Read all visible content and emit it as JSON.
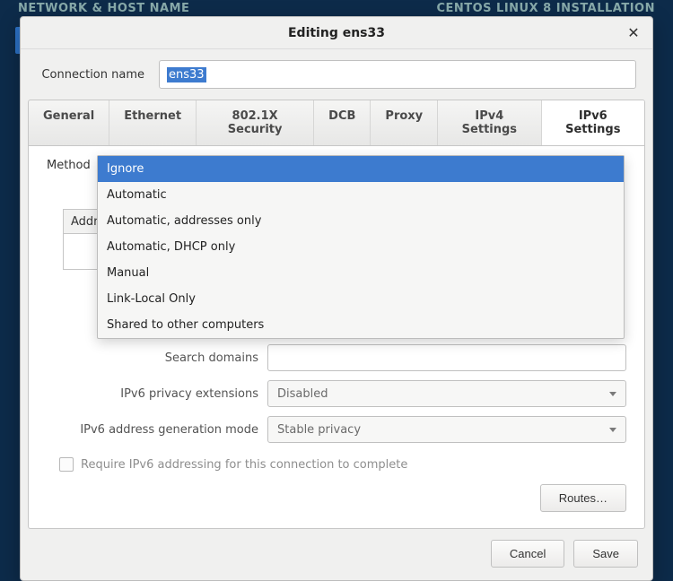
{
  "bg": {
    "left": "NETWORK & HOST NAME",
    "right": "CENTOS LINUX 8 INSTALLATION"
  },
  "dialog": {
    "title": "Editing ens33",
    "conn_label": "Connection name",
    "conn_value": "ens33"
  },
  "tabs": {
    "general": "General",
    "ethernet": "Ethernet",
    "security": "802.1X Security",
    "dcb": "DCB",
    "proxy": "Proxy",
    "ipv4": "IPv4 Settings",
    "ipv6": "IPv6 Settings"
  },
  "ipv6": {
    "method_label": "Method",
    "options": {
      "ignore": "Ignore",
      "automatic": "Automatic",
      "auto_addr": "Automatic, addresses only",
      "auto_dhcp": "Automatic, DHCP only",
      "manual": "Manual",
      "linklocal": "Link-Local Only",
      "shared": "Shared to other computers"
    },
    "addr_header": "Address",
    "search_domains_label": "Search domains",
    "privacy_label": "IPv6 privacy extensions",
    "privacy_value": "Disabled",
    "addrgen_label": "IPv6 address generation mode",
    "addrgen_value": "Stable privacy",
    "require_label": "Require IPv6 addressing for this connection to complete",
    "routes_btn": "Routes…"
  },
  "buttons": {
    "cancel": "Cancel",
    "save": "Save"
  }
}
